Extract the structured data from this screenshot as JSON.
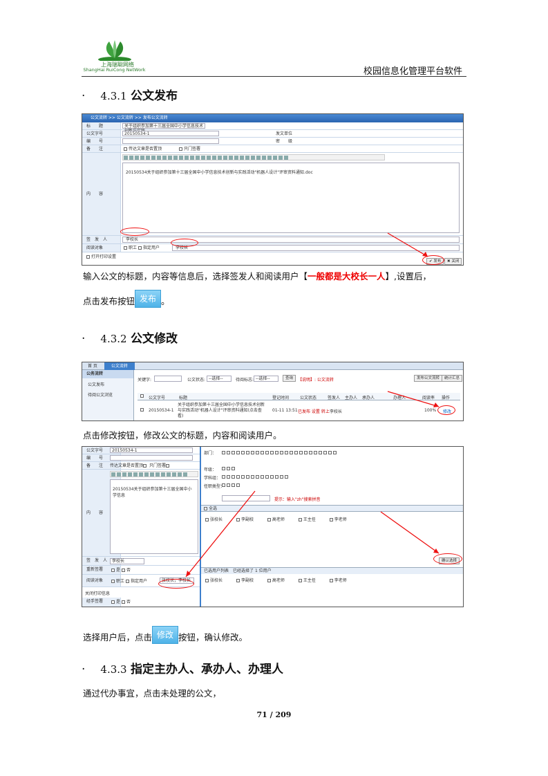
{
  "header": {
    "logo_cn": "上海瑞聪网络",
    "logo_en": "ShangHai RuiCong NetWork",
    "title": "校园信息化管理平台软件"
  },
  "colors": {
    "accent_red": "#e00000",
    "button_blue": "#4fb3e8",
    "bar_blue": "#2a64b0"
  },
  "sections": [
    {
      "bullet": "·",
      "number": "4.3.1",
      "title": "公文发布"
    },
    {
      "bullet": "·",
      "number": "4.3.2",
      "title": "公文修改"
    },
    {
      "bullet": "·",
      "number": "4.3.3",
      "title": "指定主办人、承办人、办理人"
    }
  ],
  "paragraphs": {
    "p1_a": "输入公文的标题，内容等信息后，选择签发人和阅读用户【",
    "p1_red": "一般都是大校长一人",
    "p1_b": "】,设置后，",
    "p1_c": "点击发布按钮",
    "p1_d": "。",
    "publish_btn": "发布",
    "p2": "点击修改按钮，修改公文的标题，内容和阅读用户。",
    "p3_a": "选择用户后，点击",
    "modify_btn": "修改",
    "p3_b": "按钮，确认修改。",
    "p4": "通过代办事宜，点击未处理的公文，"
  },
  "shot1": {
    "breadcrumb": "公文流转 >> 公文流转 >> 发布公文流转",
    "labels": [
      "标　　题",
      "公文字号",
      "编　　号",
      "备　　注",
      "内　　容",
      "签　发　人",
      "阅读对象"
    ],
    "title_val": "关于组织参加第十三届全国中小学信息技术创新与实践",
    "doc_no": "2015053​4-1",
    "unit_label": "发文单位",
    "secret_label": "密　　级",
    "remark_opts": [
      "传达文章是否置顶",
      "只门签署"
    ],
    "attachment": "20150534关于组织参加第十三届全国中小学信息技术创新与实践活动\"机器人设计\"评审资料通知.doc",
    "signer": "李校长",
    "reader_opts": [
      "职工",
      "指定用户"
    ],
    "reader_val": "李校长",
    "print_label": "打开打印设置",
    "publish": "发布",
    "close": "关闭"
  },
  "shot2": {
    "tabs": [
      "首 页",
      "公文流转"
    ],
    "sidebar_title": "公务流转",
    "sidebar_items": [
      "公文发布",
      "待阅公文浏览"
    ],
    "search_label": "关键字:",
    "state_label": "公文状态:",
    "state_val": "--选择--",
    "sign_label": "待阅标志:",
    "sign_val": "--选择--",
    "query": "查询",
    "hint": "【说明】: 公文流转",
    "btn_publish": "发布公文流转",
    "btn_stats": "统计汇总",
    "columns": [
      "",
      "公文字号",
      "标题",
      "登记时间",
      "公文状态",
      "签发人",
      "主办人",
      "承办人",
      "办理人",
      "阅读率",
      "操作"
    ],
    "row": {
      "no": "20150534-1",
      "title": "关于组织参加第十三届全国中小学信息技术创新与实践活动\"机器人设计\"评审资料通知(点击查看)",
      "date": "01-11 13:51",
      "state": "已发布 设置 转上",
      "signer": "李校长",
      "rate": "100%",
      "op": "修改"
    }
  },
  "shot3": {
    "labels": [
      "公文字号",
      "编　　号",
      "备　　注",
      "内　　容",
      "签　发　人",
      "重新签署",
      "阅读对象"
    ],
    "doc_no": "20150534-1",
    "remark_opts": [
      "传达文章是否置顶",
      "只门签署"
    ],
    "attachment": "20150534关于组织参加第十三届全国中小学信息",
    "signer": "李校长",
    "resign_opts": [
      "是",
      "否"
    ],
    "reader_opts": [
      "职工",
      "指定用户"
    ],
    "reader_val": "张校长，李校长",
    "close_label": "关闭打印信息",
    "check_label": "经手签署",
    "check_opts": [
      "是",
      "否"
    ],
    "dlg_rows": [
      "部门：",
      "年级：",
      "学科组：",
      "任职类型："
    ],
    "dlg_hint": "提示：输入\"zh\"搜索拼音",
    "select_all": "全选",
    "users": [
      "张校长",
      "李副校",
      "高老师",
      "王主任",
      "李老师"
    ],
    "confirm": "确认选择",
    "selected_label": "已选用户列表",
    "selected_hint": "已经选择了 1 位用户"
  },
  "footer": "71 / 209"
}
